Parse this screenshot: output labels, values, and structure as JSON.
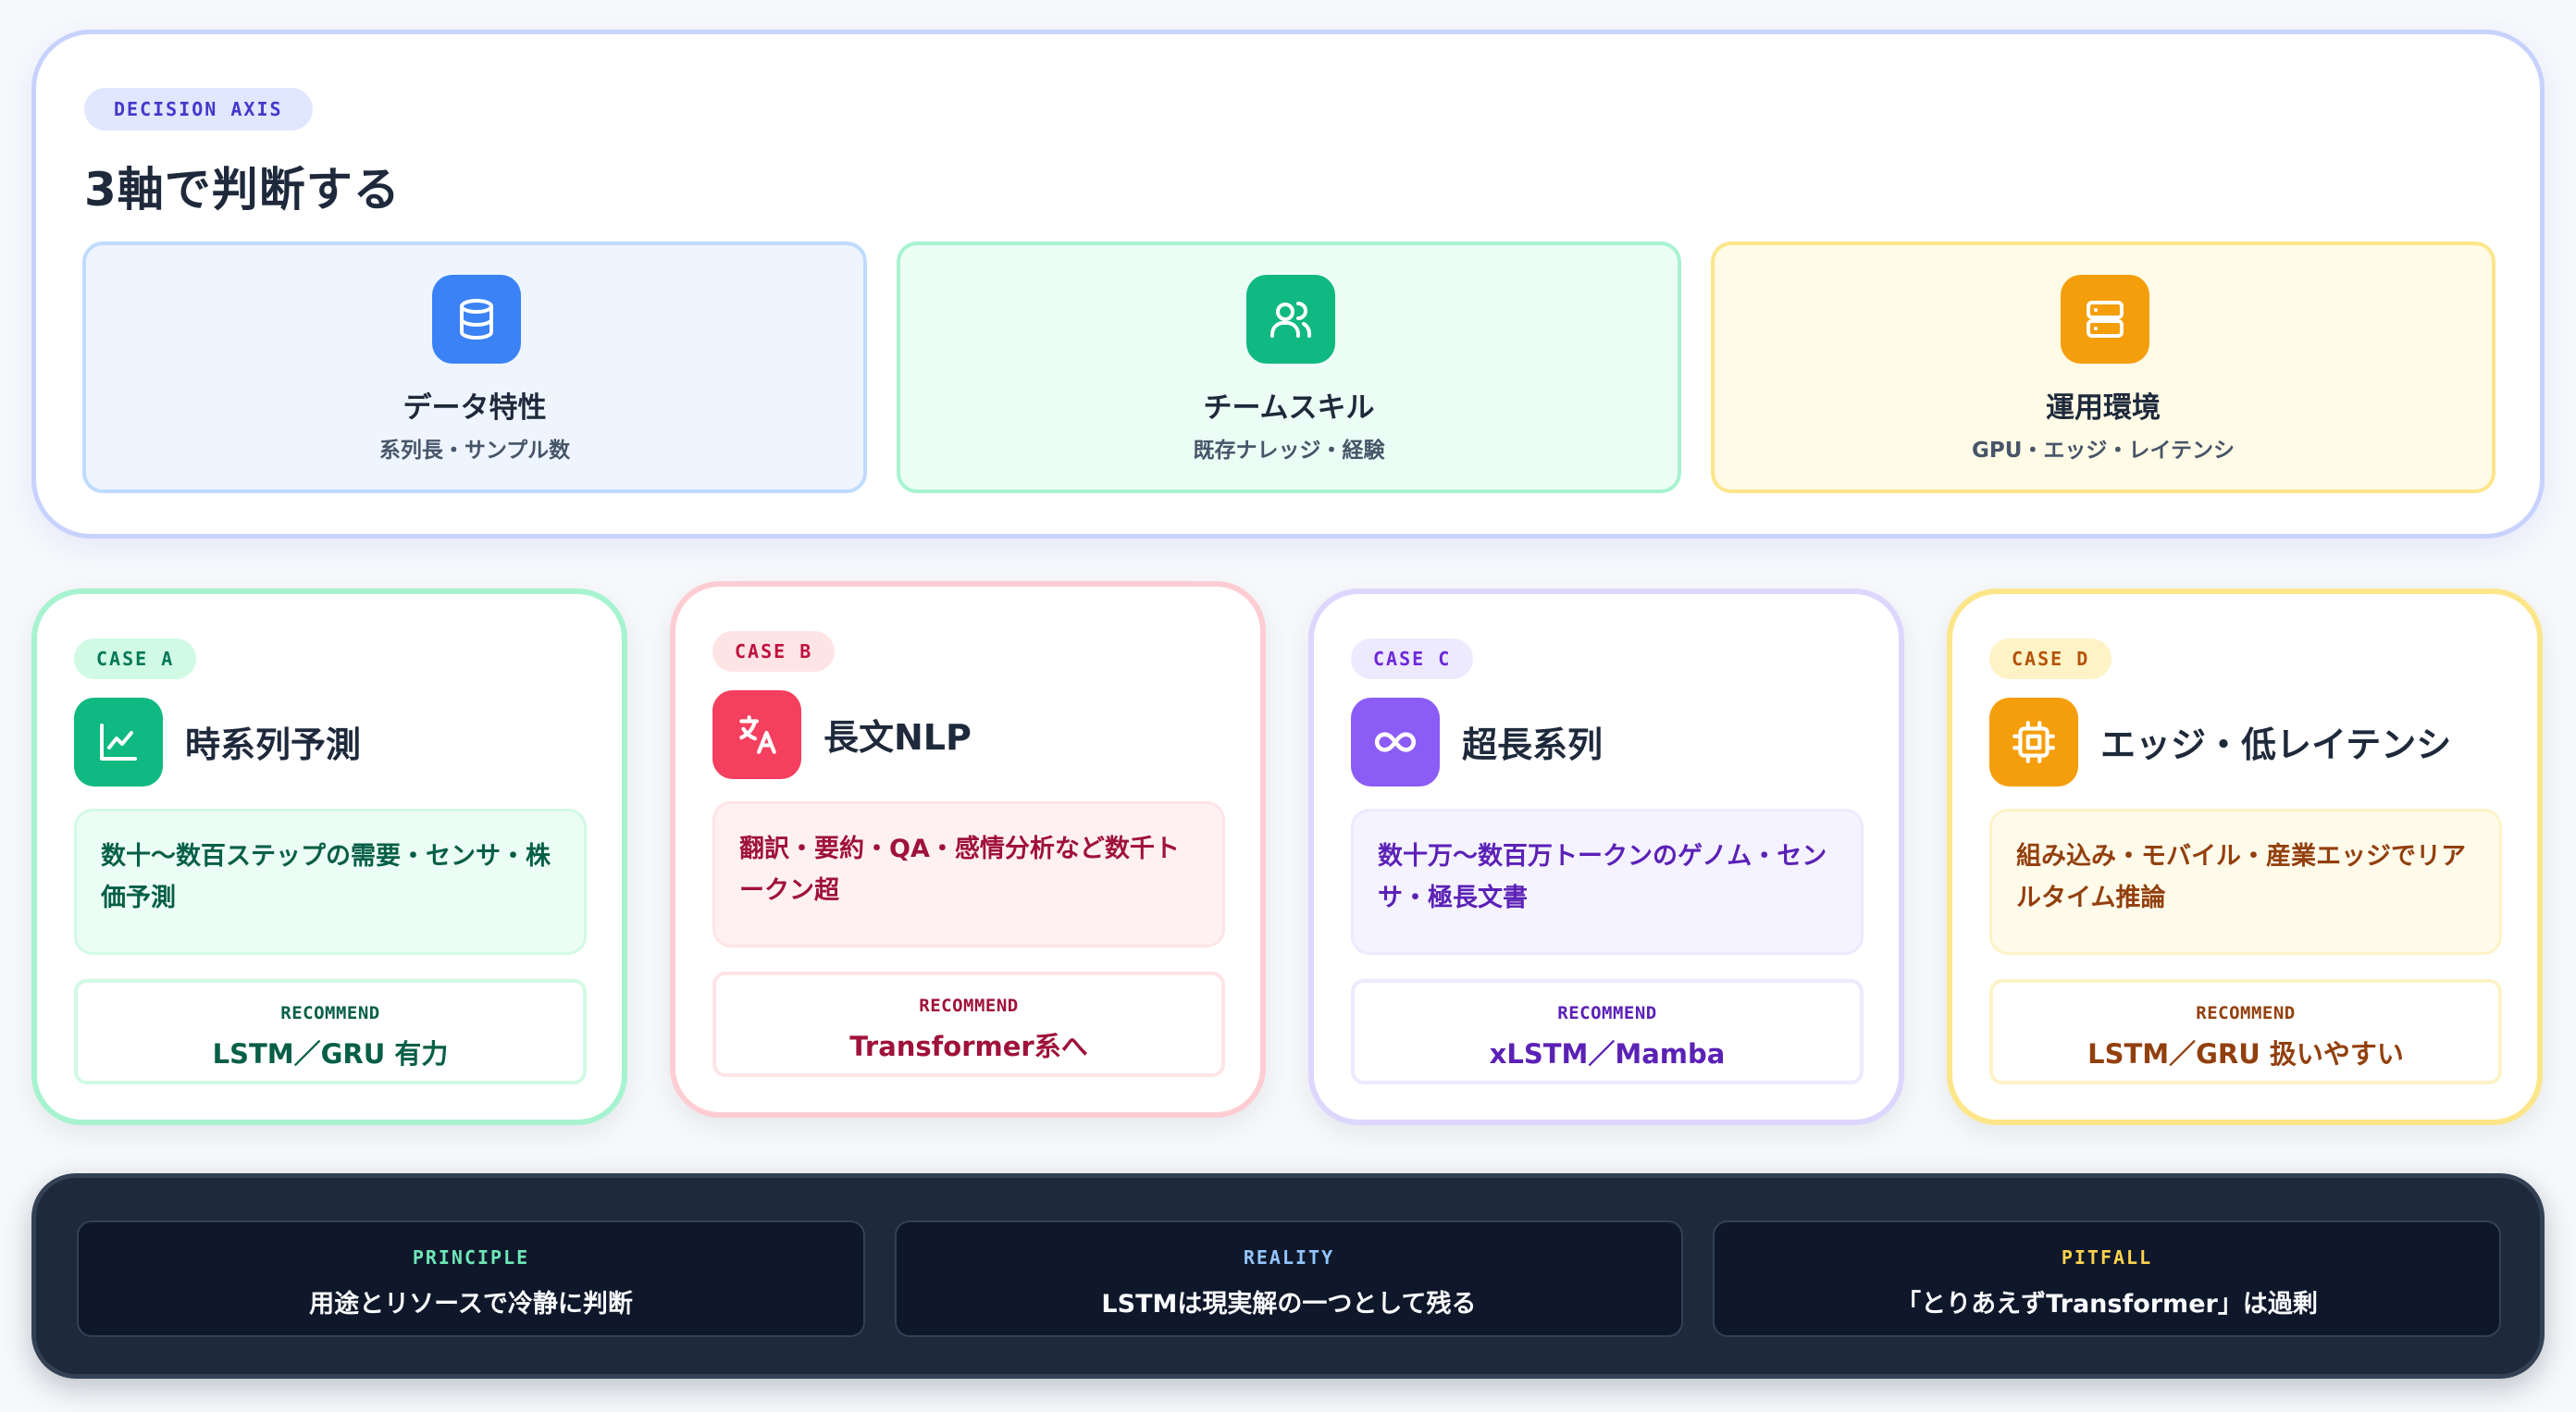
{
  "axis": {
    "badge": "DECISION AXIS",
    "title": "3軸で判断する",
    "cards": [
      {
        "icon": "database-icon",
        "title": "データ特性",
        "subtitle": "系列長・サンプル数"
      },
      {
        "icon": "team-icon",
        "title": "チームスキル",
        "subtitle": "既存ナレッジ・経験"
      },
      {
        "icon": "server-icon",
        "title": "運用環境",
        "subtitle": "GPU・エッジ・レイテンシ"
      }
    ]
  },
  "cases": [
    {
      "badge": "CASE A",
      "icon": "line-chart-icon",
      "title": "時系列予測",
      "description": "数十〜数百ステップの需要・センサ・株価予測",
      "recommend_label": "RECOMMEND",
      "recommend": "LSTM／GRU 有力"
    },
    {
      "badge": "CASE B",
      "icon": "translate-icon",
      "title": "長文NLP",
      "description": "翻訳・要約・QA・感情分析など数千トークン超",
      "recommend_label": "RECOMMEND",
      "recommend": "Transformer系へ"
    },
    {
      "badge": "CASE C",
      "icon": "infinity-icon",
      "title": "超長系列",
      "description": "数十万〜数百万トークンのゲノム・センサ・極長文書",
      "recommend_label": "RECOMMEND",
      "recommend": "xLSTM／Mamba"
    },
    {
      "badge": "CASE D",
      "icon": "chip-icon",
      "title": "エッジ・低レイテンシ",
      "description": "組み込み・モバイル・産業エッジでリアルタイム推論",
      "recommend_label": "RECOMMEND",
      "recommend": "LSTM／GRU 扱いやすい"
    }
  ],
  "footer": [
    {
      "label": "PRINCIPLE",
      "text": "用途とリソースで冷静に判断"
    },
    {
      "label": "REALITY",
      "text": "LSTMは現実解の一つとして残る"
    },
    {
      "label": "PITFALL",
      "text": "「とりあえずTransformer」は過剰"
    }
  ]
}
